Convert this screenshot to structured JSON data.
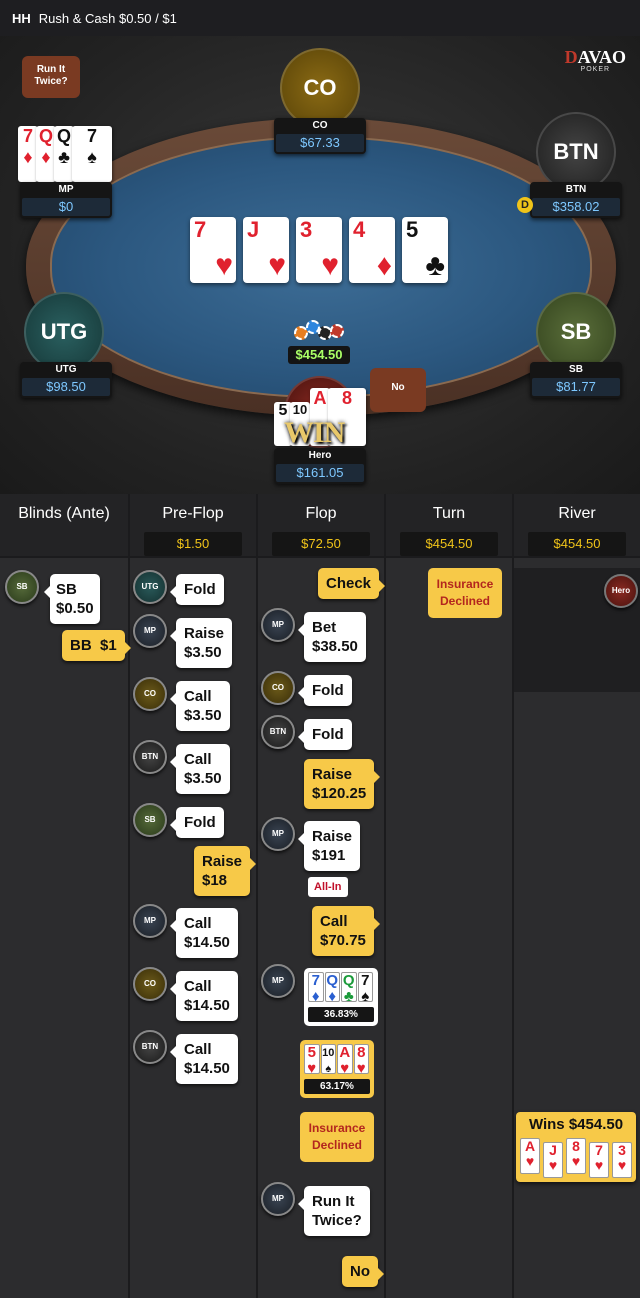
{
  "header": {
    "hh": "HH",
    "title": "Rush & Cash $0.50 / $1"
  },
  "logo": {
    "brand_a": "D",
    "brand_b": "VAO",
    "brand_c": "A",
    "sub": "POKER"
  },
  "seats": {
    "co": {
      "label": "CO",
      "name": "CO",
      "stack": "$67.33"
    },
    "mp": {
      "name": "MP",
      "stack": "$0"
    },
    "btn": {
      "label": "BTN",
      "name": "BTN",
      "stack": "$358.02"
    },
    "utg": {
      "label": "UTG",
      "name": "UTG",
      "stack": "$98.50"
    },
    "sb": {
      "label": "SB",
      "name": "SB",
      "stack": "$81.77"
    },
    "hero": {
      "name": "Hero",
      "stack": "$161.05"
    }
  },
  "bubbles": {
    "run_it_twice": "Run It Twice?",
    "no": "No"
  },
  "dealer": "D",
  "win_text": "WIN",
  "pot": "$454.50",
  "board": [
    {
      "rank": "7",
      "suit": "♥",
      "color": "red"
    },
    {
      "rank": "J",
      "suit": "♥",
      "color": "red"
    },
    {
      "rank": "3",
      "suit": "♥",
      "color": "red"
    },
    {
      "rank": "4",
      "suit": "♦",
      "color": "red"
    },
    {
      "rank": "5",
      "suit": "♣",
      "color": "black"
    }
  ],
  "mp_hand": [
    {
      "rank": "7",
      "suit": "♦"
    },
    {
      "rank": "Q",
      "suit": "♦"
    },
    {
      "rank": "Q",
      "suit": "♣"
    },
    {
      "rank": "7",
      "suit": "♠"
    }
  ],
  "hero_hand": [
    {
      "rank": "5"
    },
    {
      "rank": "10"
    },
    {
      "rank": "A"
    },
    {
      "rank": "8"
    }
  ],
  "history": {
    "columns": [
      {
        "title": "Blinds (Ante)",
        "amount": ""
      },
      {
        "title": "Pre-Flop",
        "amount": "$1.50"
      },
      {
        "title": "Flop",
        "amount": "$72.50"
      },
      {
        "title": "Turn",
        "amount": "$454.50"
      },
      {
        "title": "River",
        "amount": "$454.50"
      }
    ],
    "avatars": {
      "sb": "SB",
      "utg": "UTG",
      "mp": "MP",
      "co": "CO",
      "btn": "BTN",
      "hero": "Hero"
    },
    "blinds": {
      "sb_a": "SB",
      "sb_b": "$0.50",
      "bb": "BB  $1"
    },
    "preflop": {
      "fold1": "Fold",
      "raise1a": "Raise",
      "raise1b": "$3.50",
      "call1a": "Call",
      "call1b": "$3.50",
      "call2a": "Call",
      "call2b": "$3.50",
      "fold2": "Fold",
      "raise2a": "Raise",
      "raise2b": "$18",
      "call3a": "Call",
      "call3b": "$14.50",
      "call4a": "Call",
      "call4b": "$14.50",
      "call5a": "Call",
      "call5b": "$14.50"
    },
    "flop": {
      "check": "Check",
      "bet_a": "Bet",
      "bet_b": "$38.50",
      "fold1": "Fold",
      "fold2": "Fold",
      "raise1a": "Raise",
      "raise1b": "$120.25",
      "raise2a": "Raise",
      "raise2b": "$191",
      "allin": "All-In",
      "call_a": "Call",
      "call_b": "$70.75",
      "mp_equity": "36.83%",
      "hero_equity": "63.17%",
      "ins_a": "Insurance",
      "ins_b": "Declined",
      "rit_a": "Run It",
      "rit_b": "Twice?",
      "no": "No"
    },
    "turn": {
      "ins_a": "Insurance",
      "ins_b": "Declined"
    },
    "river": {
      "wins": "Wins $454.50"
    },
    "mp_eq_cards": [
      {
        "r": "7",
        "s": "♦",
        "c": "blu"
      },
      {
        "r": "Q",
        "s": "♦",
        "c": "blu"
      },
      {
        "r": "Q",
        "s": "♣",
        "c": "grn"
      },
      {
        "r": "7",
        "s": "♠",
        "c": "dk"
      }
    ],
    "hero_eq_cards": [
      {
        "r": "5",
        "s": "♥",
        "c": "red"
      },
      {
        "r": "10",
        "s": "♠",
        "c": "dk"
      },
      {
        "r": "A",
        "s": "♥",
        "c": "red"
      },
      {
        "r": "8",
        "s": "♥",
        "c": "red"
      }
    ],
    "win_cards": [
      {
        "r": "A",
        "s": "♥"
      },
      {
        "r": "J",
        "s": "♥"
      },
      {
        "r": "8",
        "s": "♥"
      },
      {
        "r": "7",
        "s": "♥"
      },
      {
        "r": "3",
        "s": "♥"
      }
    ]
  }
}
